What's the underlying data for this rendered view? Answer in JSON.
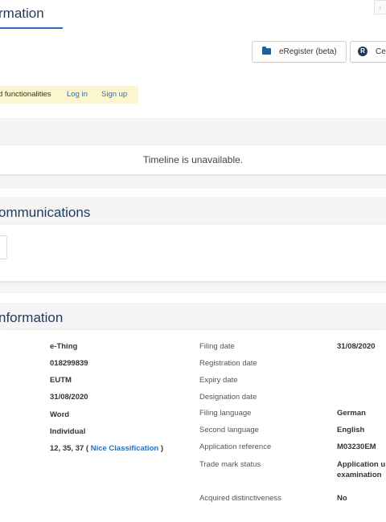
{
  "header": {
    "tab_title": "rmation",
    "corner_button": "‹"
  },
  "toolbar": {
    "eregister_label": "eRegister (beta)",
    "ce_label": "Ce",
    "r_glyph": "R"
  },
  "notice": {
    "text": "d functionalities",
    "login": "Log in",
    "signup": "Sign up"
  },
  "timeline": {
    "message": "Timeline is unavailable."
  },
  "communications": {
    "title": "ommunications"
  },
  "information": {
    "title": "nformation",
    "left_values": {
      "name": "e-Thing",
      "number": "018299839",
      "type": "EUTM",
      "date": "31/08/2020",
      "kind": "Word",
      "nature": "Individual",
      "classes": "12, 35, 37 (",
      "nice_link": "Nice Classification",
      "classes_close": ")"
    },
    "right_labels": {
      "filing_date": "Filing date",
      "registration_date": "Registration date",
      "expiry_date": "Expiry date",
      "designation_date": "Designation date",
      "filing_language": "Filing language",
      "second_language": "Second language",
      "application_reference": "Application reference",
      "trade_mark_status": "Trade mark status",
      "acquired_distinctiveness": "Acquired distinctiveness"
    },
    "right_values": {
      "filing_date": "31/08/2020",
      "filing_language": "German",
      "second_language": "English",
      "application_reference": "M03230EM",
      "status_line1": "Application u",
      "status_line2": "examination",
      "acquired_distinctiveness": "No"
    }
  }
}
